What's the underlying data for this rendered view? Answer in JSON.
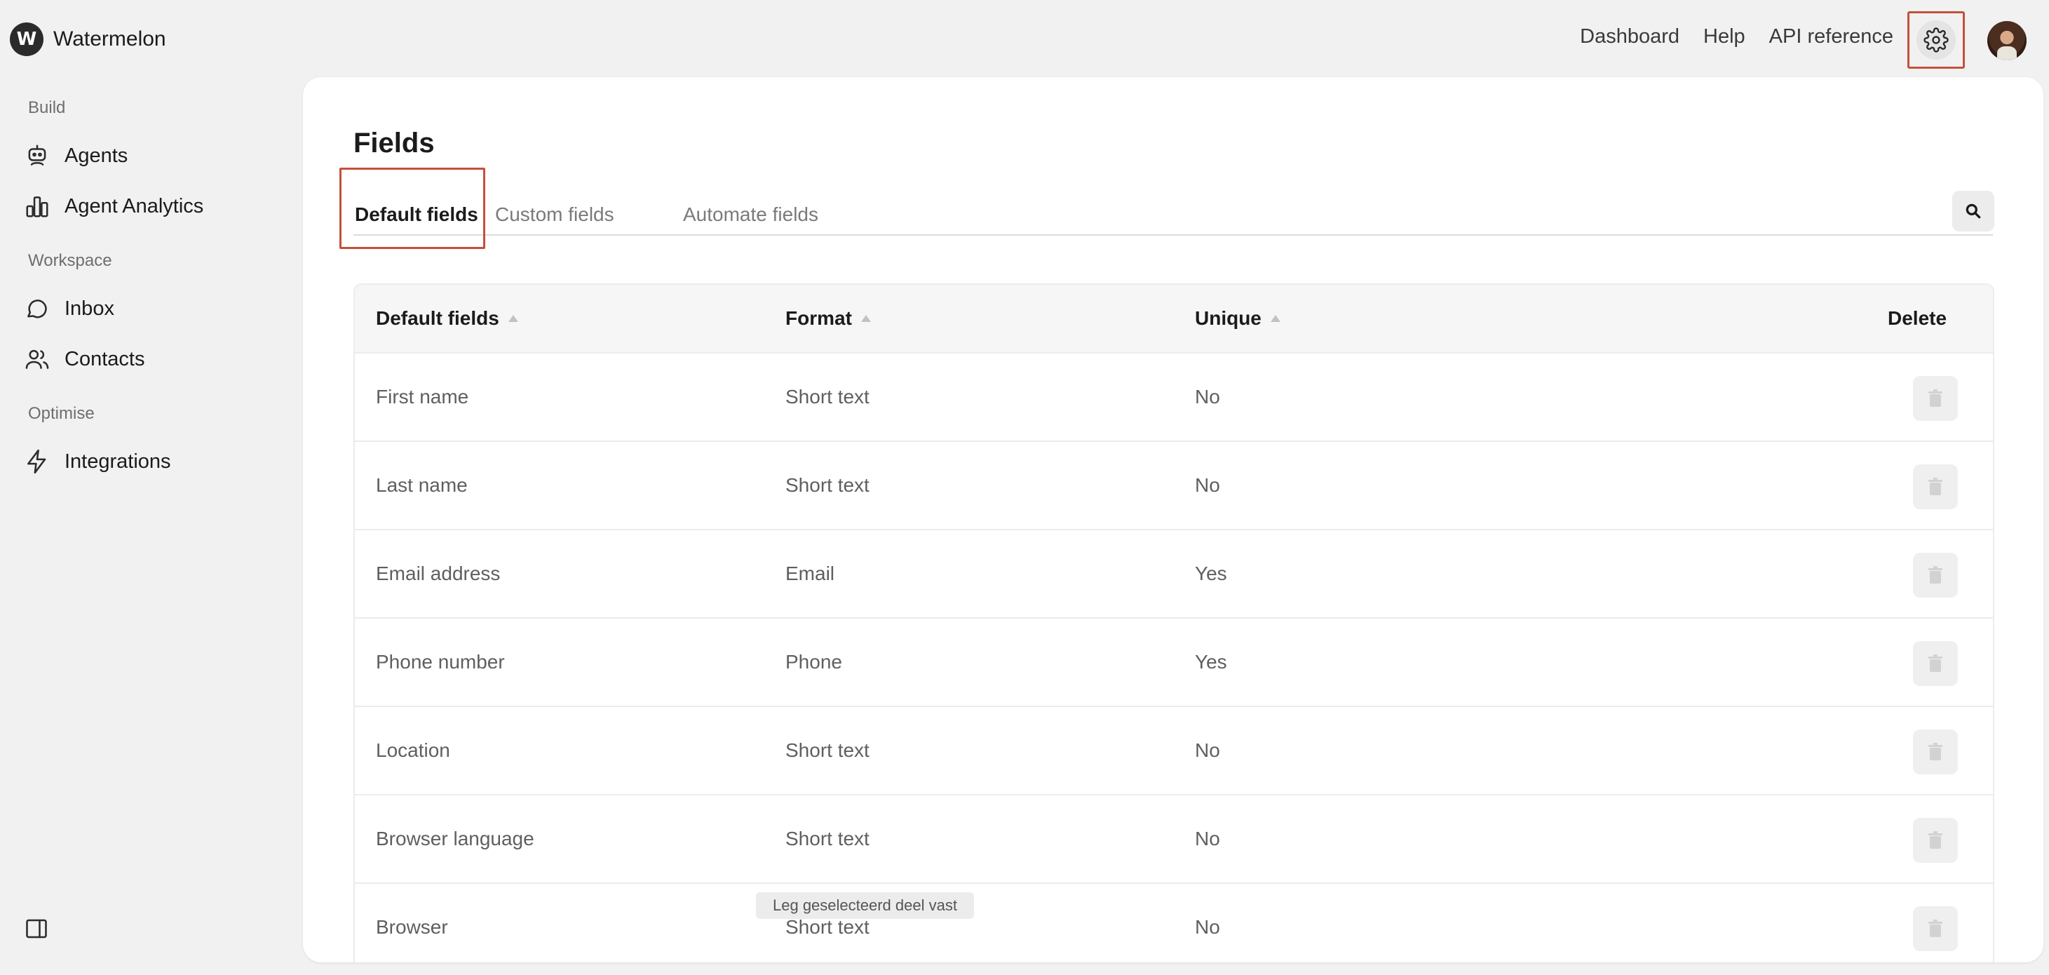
{
  "app": {
    "logo_letter": "W",
    "name": "Watermelon"
  },
  "topnav": {
    "items": [
      "Dashboard",
      "Help",
      "API reference"
    ]
  },
  "icons": {
    "settings": "gear-icon",
    "search": "search-icon",
    "delete": "trash-icon",
    "collapse": "sidebar-toggle-icon"
  },
  "sidebar": {
    "sections": [
      {
        "label": "Build",
        "items": [
          {
            "label": "Agents",
            "icon": "bot-icon"
          },
          {
            "label": "Agent Analytics",
            "icon": "bar-chart-icon"
          }
        ]
      },
      {
        "label": "Workspace",
        "items": [
          {
            "label": "Inbox",
            "icon": "chat-bubble-icon"
          },
          {
            "label": "Contacts",
            "icon": "users-icon"
          }
        ]
      },
      {
        "label": "Optimise",
        "items": [
          {
            "label": "Integrations",
            "icon": "bolt-icon"
          }
        ]
      }
    ]
  },
  "page": {
    "title": "Fields"
  },
  "tabs": [
    {
      "label": "Default fields",
      "active": true
    },
    {
      "label": "Custom fields",
      "active": false
    },
    {
      "label": "Automate fields",
      "active": false
    }
  ],
  "table": {
    "headers": [
      "Default fields",
      "Format",
      "Unique",
      "Delete"
    ],
    "rows": [
      {
        "name": "First name",
        "format": "Short text",
        "unique": "No"
      },
      {
        "name": "Last name",
        "format": "Short text",
        "unique": "No"
      },
      {
        "name": "Email address",
        "format": "Email",
        "unique": "Yes"
      },
      {
        "name": "Phone number",
        "format": "Phone",
        "unique": "Yes"
      },
      {
        "name": "Location",
        "format": "Short text",
        "unique": "No"
      },
      {
        "name": "Browser language",
        "format": "Short text",
        "unique": "No"
      },
      {
        "name": "Browser",
        "format": "Short text",
        "unique": "No"
      }
    ]
  },
  "tooltip": {
    "text": "Leg geselecteerd deel vast"
  },
  "colors": {
    "highlight": "#c4503c",
    "background": "#f1f1f1",
    "panel": "#ffffff"
  }
}
